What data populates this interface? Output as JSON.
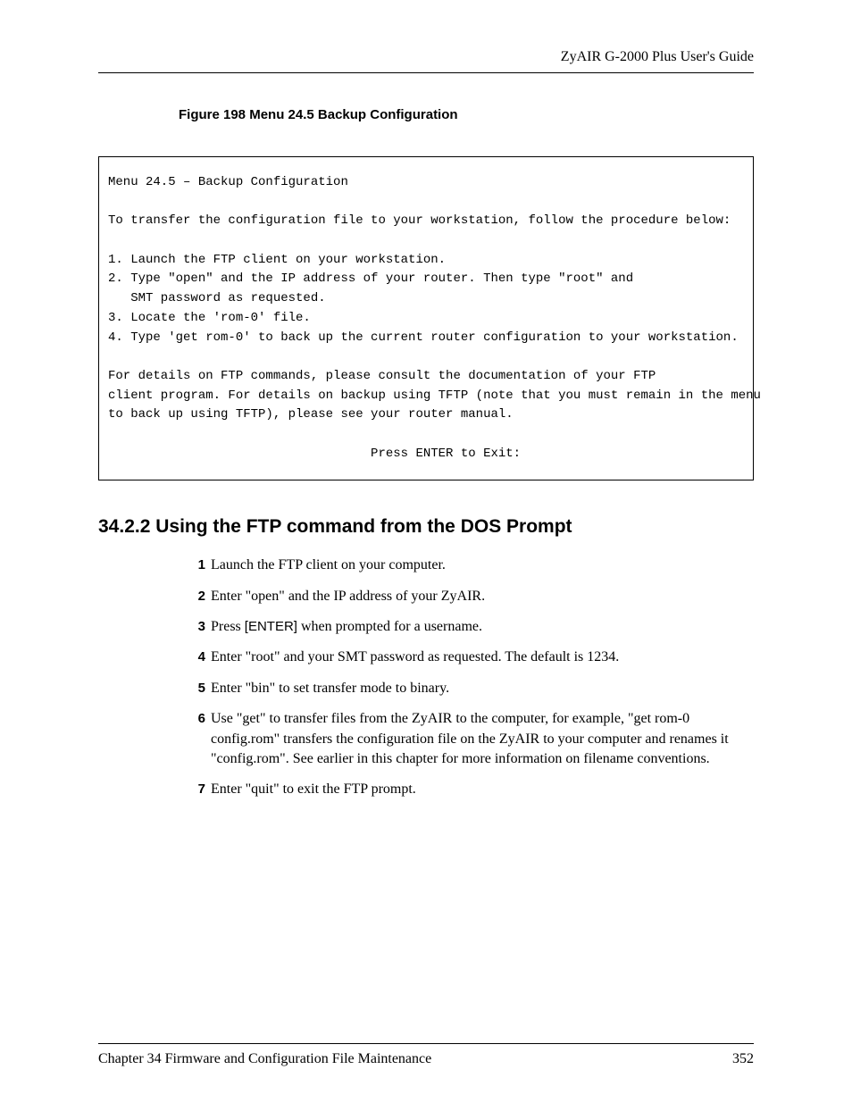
{
  "header": {
    "guide_title": "ZyAIR G-2000 Plus User's Guide"
  },
  "figure": {
    "caption": "Figure 198   Menu 24.5 Backup Configuration"
  },
  "code": {
    "line1": "Menu 24.5 – Backup Configuration",
    "line2": "To transfer the configuration file to your workstation, follow the procedure below:",
    "line3": "1. Launch the FTP client on your workstation.",
    "line4": "2. Type \"open\" and the IP address of your router. Then type \"root\" and",
    "line5": "   SMT password as requested.",
    "line6": "3. Locate the 'rom-0' file.",
    "line7": "4. Type 'get rom-0' to back up the current router configuration to your workstation.",
    "line8": "For details on FTP commands, please consult the documentation of your FTP",
    "line9": "client program. For details on backup using TFTP (note that you must remain in the menu",
    "line10": "to back up using TFTP), please see your router manual.",
    "line11": "                                   Press ENTER to Exit:"
  },
  "section": {
    "heading": "34.2.2  Using the FTP command from the DOS Prompt"
  },
  "steps": {
    "n1": "1",
    "t1": "Launch the FTP client on your computer.",
    "n2": "2",
    "t2": "Enter \"open\" and the IP address of your ZyAIR.",
    "n3": "3",
    "t3a": "Press ",
    "t3b": "[ENTER]",
    "t3c": " when prompted for a username.",
    "n4": "4",
    "t4": "Enter \"root\" and your SMT password as requested. The default is 1234.",
    "n5": "5",
    "t5": "Enter \"bin\" to set transfer mode to binary.",
    "n6": "6",
    "t6": "Use \"get\" to transfer files from the ZyAIR to the computer, for example, \"get rom-0 config.rom\" transfers the configuration file on the ZyAIR to your computer and renames it \"config.rom\". See earlier in this chapter for more information on filename conventions.",
    "n7": "7",
    "t7": "Enter \"quit\" to exit the FTP prompt."
  },
  "footer": {
    "chapter": "Chapter 34 Firmware and Configuration File Maintenance",
    "page": "352"
  }
}
